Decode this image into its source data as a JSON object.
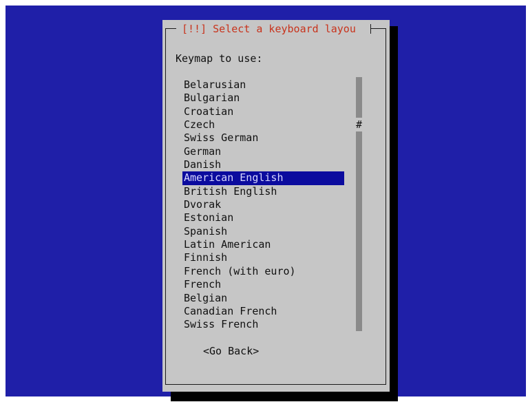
{
  "dialog": {
    "title": "[!!] Select a keyboard layou",
    "prompt": "Keymap to use:",
    "selected_index": 7,
    "items": [
      "Belarusian",
      "Bulgarian",
      "Croatian",
      "Czech",
      "Swiss German",
      "German",
      "Danish",
      "American English",
      "British English",
      "Dvorak",
      "Estonian",
      "Spanish",
      "Latin American",
      "Finnish",
      "French (with euro)",
      "French",
      "Belgian",
      "Canadian French",
      "Swiss French"
    ],
    "scroll_marker": "#",
    "back_button": "<Go Back>"
  },
  "colors": {
    "desktop": "#1f1fa8",
    "dialog": "#c6c6c6",
    "title_text": "#c8331c",
    "selection": "#0b0b9e"
  }
}
